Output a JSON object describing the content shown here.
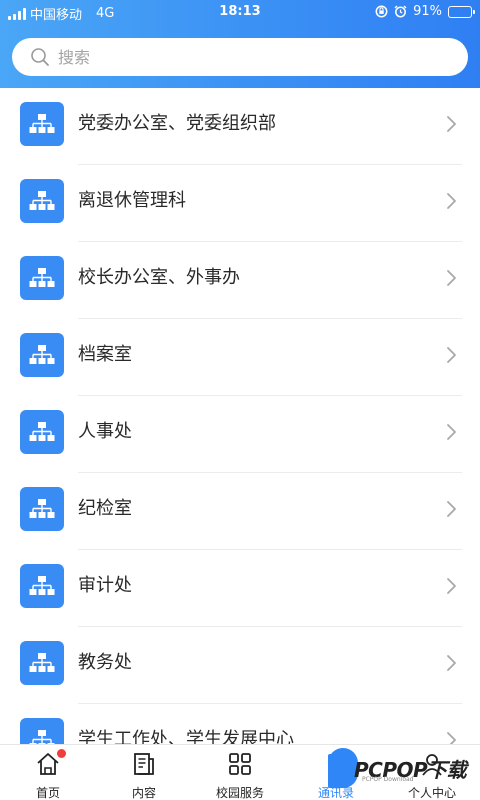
{
  "status_bar": {
    "carrier": "中国移动",
    "network": "4G",
    "time": "18:13",
    "battery": "91%",
    "battery_level": 0.91
  },
  "search": {
    "placeholder": "搜索"
  },
  "departments": [
    {
      "label": "党委办公室、党委组织部"
    },
    {
      "label": "离退休管理科"
    },
    {
      "label": "校长办公室、外事办"
    },
    {
      "label": "档案室"
    },
    {
      "label": "人事处"
    },
    {
      "label": "纪检室"
    },
    {
      "label": "审计处"
    },
    {
      "label": "教务处"
    },
    {
      "label": "学生工作处、学生发展中心"
    }
  ],
  "tabs": [
    {
      "label": "首页",
      "icon": "home-icon",
      "badge": true
    },
    {
      "label": "内容",
      "icon": "document-icon"
    },
    {
      "label": "校园服务",
      "icon": "grid-icon"
    },
    {
      "label": "通讯录",
      "icon": "contacts-icon",
      "active": true
    },
    {
      "label": "个人中心",
      "icon": "person-icon"
    }
  ],
  "watermark": {
    "text": "PCPOP下载",
    "sub": "PCPOP Download"
  },
  "colors": {
    "accent": "#2f86f6",
    "header_start": "#4aa6f6",
    "header_end": "#2f7ff3",
    "icon_bg": "#3a8cf5",
    "badge": "#f23c3c"
  }
}
